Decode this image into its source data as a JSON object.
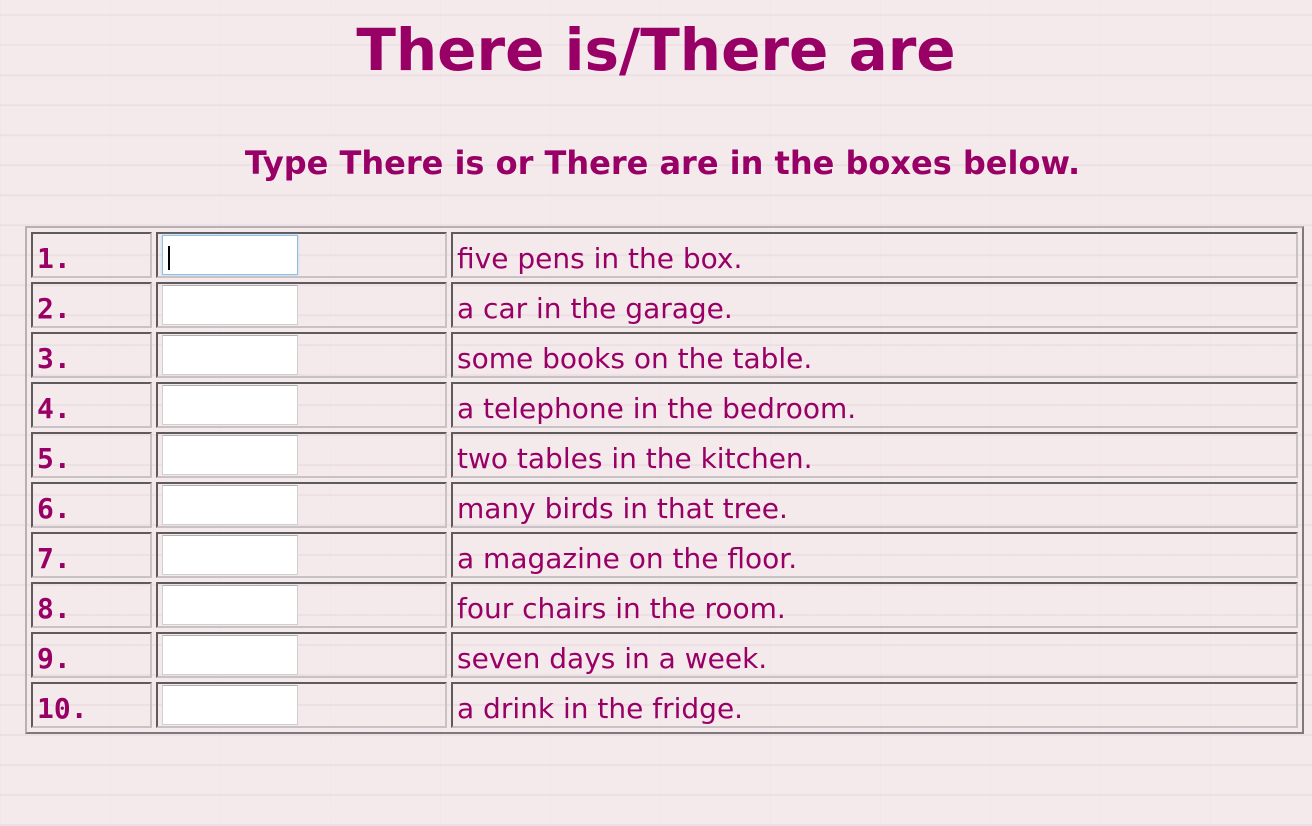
{
  "page": {
    "title": "There is/There are",
    "instructions": "Type There is or There are in the boxes below."
  },
  "colors": {
    "text": "#990066",
    "background": "#f4eaec",
    "input_background": "#ffffff",
    "focus_border": "#8cc0e8"
  },
  "rows": [
    {
      "number": "1.",
      "answer": "",
      "sentence": "five pens in the box."
    },
    {
      "number": "2.",
      "answer": "",
      "sentence": "a car in the garage."
    },
    {
      "number": "3.",
      "answer": "",
      "sentence": "some books on the table."
    },
    {
      "number": "4.",
      "answer": "",
      "sentence": "a telephone in the bedroom."
    },
    {
      "number": "5.",
      "answer": "",
      "sentence": "two tables in the kitchen."
    },
    {
      "number": "6.",
      "answer": "",
      "sentence": "many birds in that tree."
    },
    {
      "number": "7.",
      "answer": "",
      "sentence": "a magazine on the floor."
    },
    {
      "number": "8.",
      "answer": "",
      "sentence": "four chairs in the room."
    },
    {
      "number": "9.",
      "answer": "",
      "sentence": "seven days in a week."
    },
    {
      "number": "10.",
      "answer": "",
      "sentence": "a drink in the fridge."
    }
  ]
}
